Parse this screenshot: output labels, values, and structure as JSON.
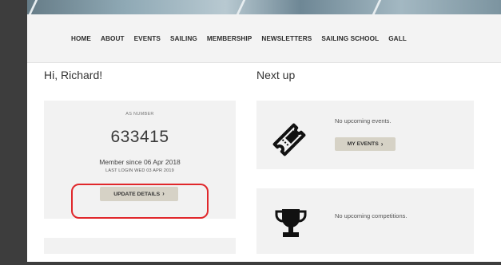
{
  "nav": {
    "items": [
      "HOME",
      "ABOUT",
      "EVENTS",
      "SAILING",
      "MEMBERSHIP",
      "NEWSLETTERS",
      "SAILING SCHOOL",
      "GALL"
    ]
  },
  "greeting": "Hi, Richard!",
  "next_up": {
    "title": "Next up",
    "events_text": "No upcoming events.",
    "my_events_label": "MY EVENTS",
    "competitions_text": "No upcoming competitions.",
    "icons": [
      "ticket-icon",
      "trophy-icon"
    ]
  },
  "member": {
    "number_label": "AS NUMBER",
    "number": "633415",
    "member_since": "Member since 06 Apr 2018",
    "last_login": "LAST LOGIN WED 03 APR 2019",
    "update_label": "UPDATE DETAILS"
  },
  "colors": {
    "highlight": "#e0272b",
    "button_bg": "#d6d2c6",
    "card_bg": "#f2f2f2",
    "nav_bg": "#f3f3f3"
  }
}
